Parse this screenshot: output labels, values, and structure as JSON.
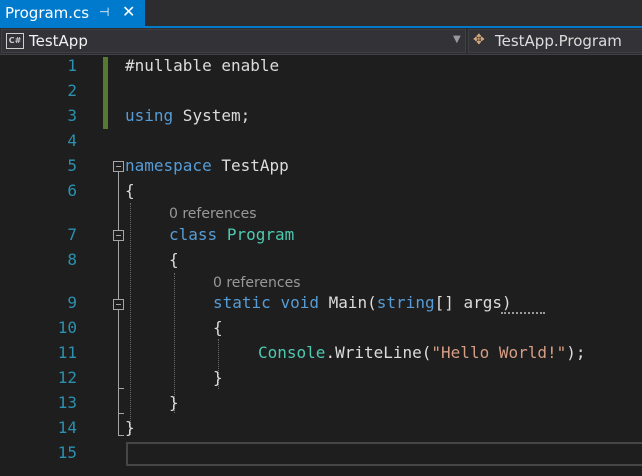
{
  "tab": {
    "title": "Program.cs",
    "pin": "⊣",
    "close": "✕"
  },
  "navbar": {
    "project": "TestApp",
    "cs_badge": "C#",
    "member": "TestApp.Program",
    "dropdown_icon": "chevron-down-icon"
  },
  "editor": {
    "lines": [
      {
        "n": "1"
      },
      {
        "n": "2"
      },
      {
        "n": "3"
      },
      {
        "n": "4"
      },
      {
        "n": "5"
      },
      {
        "n": "6"
      },
      {
        "n": "7"
      },
      {
        "n": "8"
      },
      {
        "n": "9"
      },
      {
        "n": "10"
      },
      {
        "n": "11"
      },
      {
        "n": "12"
      },
      {
        "n": "13"
      },
      {
        "n": "14"
      },
      {
        "n": "15"
      }
    ],
    "code": {
      "l1": "#nullable enable",
      "l3_kw": "using",
      "l3_rest": " System;",
      "l5_kw": "namespace",
      "l5_rest": " TestApp",
      "open": "{",
      "close": "}",
      "l7_kw": "class",
      "l7_ty": "Program",
      "l9_kw1": "static",
      "l9_kw2": "void",
      "l9_nm": "Main(",
      "l9_kw3": "string",
      "l9_rest": "[] ",
      "l9_arg": "args",
      "l9_end": ")",
      "l11_ty": "Console",
      "l11_mid": ".WriteLine(",
      "l11_str": "\"Hello World!\"",
      "l11_end": ");"
    },
    "refs": {
      "class_refs": "0 references",
      "main_refs": "0 references"
    }
  },
  "colors": {
    "keyword": "#569cd6",
    "type": "#4ec9b0",
    "string": "#d69d85",
    "line_number": "#2b91af",
    "accent": "#007acc"
  }
}
